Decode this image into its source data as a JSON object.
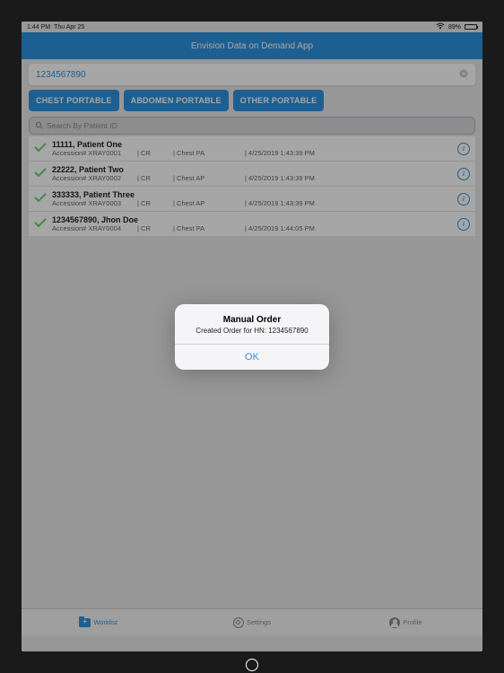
{
  "status": {
    "time": "1:44 PM",
    "date": "Thu Apr 25",
    "battery_pct": "89%"
  },
  "nav_title": "Envision Data on Demand App",
  "input_value": "1234567890",
  "buttons": {
    "chest": "CHEST PORTABLE",
    "abdomen": "ABDOMEN PORTABLE",
    "other": "OTHER PORTABLE"
  },
  "search_placeholder": "Search By Patient ID",
  "rows": [
    {
      "title": "11111, Patient One",
      "accession": "Accession# XRAY0001",
      "modality": "| CR",
      "body": "| Chest PA",
      "date": "| 4/25/2019 1:43:39 PM"
    },
    {
      "title": "22222, Patient Two",
      "accession": "Accession# XRAY0002",
      "modality": "| CR",
      "body": "| Chest AP",
      "date": "| 4/25/2019 1:43:39 PM"
    },
    {
      "title": "333333, Patient Three",
      "accession": "Accession# XRAY0003",
      "modality": "| CR",
      "body": "| Chest AP",
      "date": "| 4/25/2019 1:43:39 PM"
    },
    {
      "title": "1234567890, Jhon Doe",
      "accession": "Accession# XRAY0004",
      "modality": "| CR",
      "body": "| Chest PA",
      "date": "| 4/25/2019 1:44:05 PM"
    }
  ],
  "tabs": {
    "worklist": "Worklist",
    "settings": "Settings",
    "profile": "Profile"
  },
  "alert": {
    "title": "Manual Order",
    "message": "Created Order for HN: 1234567890",
    "ok": "OK"
  }
}
